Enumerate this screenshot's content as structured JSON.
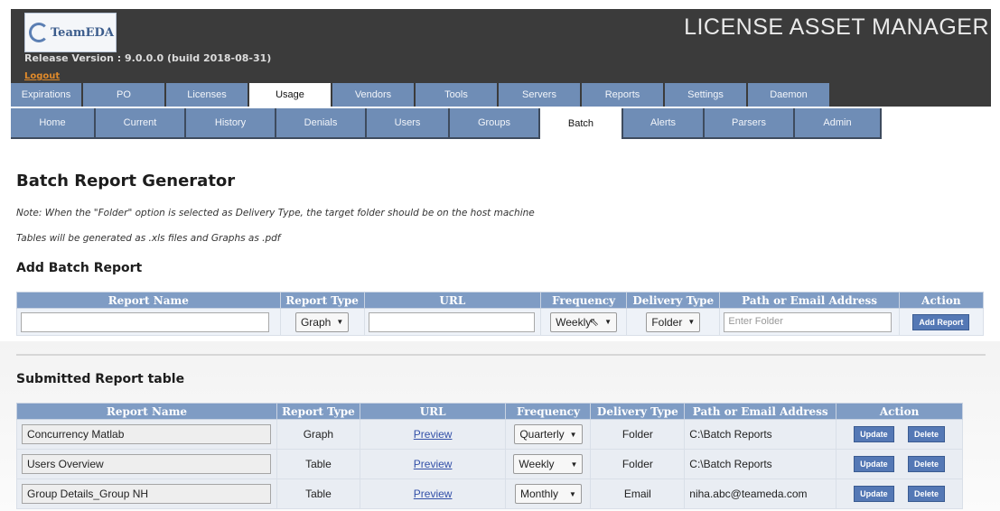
{
  "app": {
    "title": "LICENSE ASSET MANAGER",
    "logo_text": "TeamEDA",
    "release": "Release Version : 9.0.0.0 (build 2018-08-31)",
    "logout": "Logout"
  },
  "main_tabs": [
    "Expirations",
    "PO",
    "Licenses",
    "Usage",
    "Vendors",
    "Tools",
    "Servers",
    "Reports",
    "Settings",
    "Daemon"
  ],
  "main_tab_active": "Usage",
  "sub_tabs": [
    "Home",
    "Current",
    "History",
    "Denials",
    "Users",
    "Groups",
    "Batch",
    "Alerts",
    "Parsers",
    "Admin"
  ],
  "sub_tab_active": "Batch",
  "page": {
    "heading": "Batch Report Generator",
    "note1": "Note: When the \"Folder\" option is selected as Delivery Type, the target folder should be on the host machine",
    "note2": "Tables will be generated as .xls files and Graphs as .pdf",
    "add_heading": "Add Batch Report",
    "submitted_heading": "Submitted Report table"
  },
  "add_form": {
    "headers": [
      "Report Name",
      "Report Type",
      "URL",
      "Frequency",
      "Delivery Type",
      "Path or Email Address",
      "Action"
    ],
    "report_name": "",
    "report_type": "Graph",
    "url": "",
    "frequency": "Weekly",
    "delivery_type": "Folder",
    "path_placeholder": "Enter Folder",
    "add_button": "Add Report"
  },
  "submitted": {
    "headers": [
      "Report Name",
      "Report Type",
      "URL",
      "Frequency",
      "Delivery Type",
      "Path or Email Address",
      "Action"
    ],
    "rows": [
      {
        "name": "Concurrency Matlab",
        "type": "Graph",
        "url": "Preview",
        "frequency": "Quarterly",
        "delivery": "Folder",
        "path": "C:\\Batch Reports",
        "update": "Update",
        "delete": "Delete"
      },
      {
        "name": "Users Overview",
        "type": "Table",
        "url": "Preview",
        "frequency": "Weekly",
        "delivery": "Folder",
        "path": "C:\\Batch Reports",
        "update": "Update",
        "delete": "Delete"
      },
      {
        "name": "Group Details_Group NH",
        "type": "Table",
        "url": "Preview",
        "frequency": "Monthly",
        "delivery": "Email",
        "path": "niha.abc@teameda.com",
        "update": "Update",
        "delete": "Delete"
      }
    ]
  }
}
